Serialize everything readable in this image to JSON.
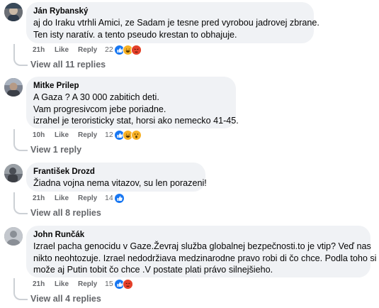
{
  "comments": [
    {
      "author": "Ján Rybanský",
      "lines": [
        "aj do Iraku vtrhli Amici, ze Sadam je tesne pred vyrobou jadrovej zbrane.",
        "Ten isty naratív. a tento pseudo krestan to obhajuje."
      ],
      "time": "21h",
      "like": "Like",
      "reply": "Reply",
      "reaction_count": "22",
      "reactions": [
        "like",
        "haha",
        "angry"
      ],
      "view_replies": "View all 11 replies"
    },
    {
      "author": "Mitke Prilep",
      "lines": [
        "A Gaza ? A 30 000 zabitich deti.",
        "Vam progresivcom jebe poriadne.",
        "izrahel je teroristicky stat, horsi ako nemecko 41-45."
      ],
      "time": "10h",
      "like": "Like",
      "reply": "Reply",
      "reaction_count": "12",
      "reactions": [
        "like",
        "haha",
        "wow"
      ],
      "view_replies": "View 1 reply"
    },
    {
      "author": "František Drozd",
      "lines": [
        "Žiadna vojna nema vitazov, su len porazeni!"
      ],
      "time": "21h",
      "like": "Like",
      "reply": "Reply",
      "reaction_count": "14",
      "reactions": [
        "like"
      ],
      "view_replies": "View all 8 replies"
    },
    {
      "author": "John Runčák",
      "lines": [
        "Izrael pacha genocidu v Gaze.Ževraj služba globalnej bezpečnosti.to je vtip? Veď nas",
        "nikto neohtozuje. Izrael nedodržiava medzinarodne pravo robi di čo chce. Podla toho si",
        "može aj Putin tobit čo chce .V postate plati právo silnejšieho."
      ],
      "time": "21h",
      "like": "Like",
      "reply": "Reply",
      "reaction_count": "15",
      "reactions": [
        "like",
        "angry"
      ],
      "view_replies": "View all 4 replies"
    }
  ],
  "colors": {
    "bubble": "#f0f2f5",
    "secondary_text": "#65676b",
    "like_blue": "#1877f2",
    "haha_yellow": "#f7b125",
    "angry_orange": "#e9710f"
  }
}
